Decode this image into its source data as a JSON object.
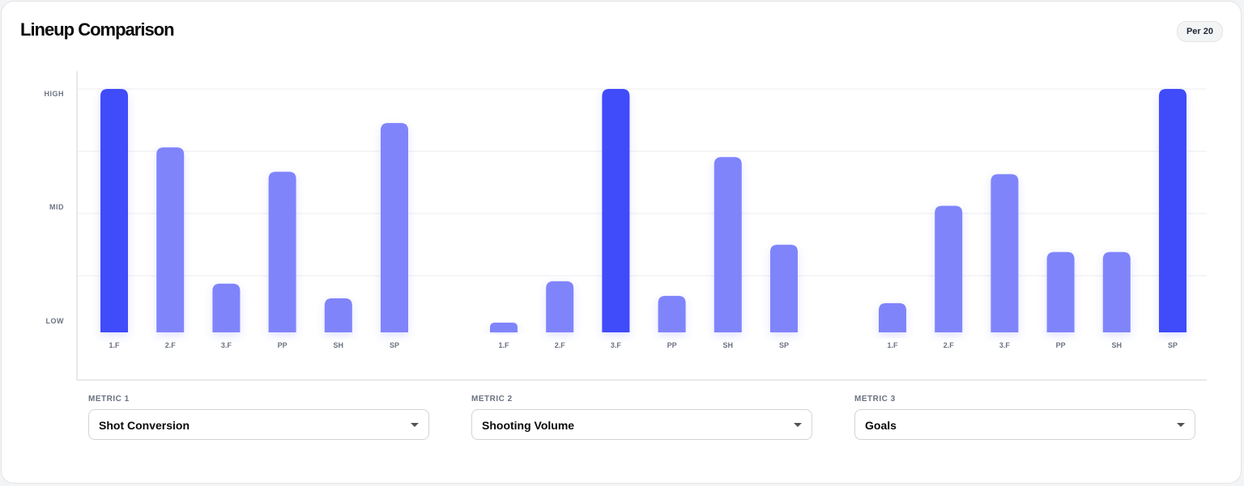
{
  "header": {
    "title": "Lineup Comparison",
    "badge": "Per 20"
  },
  "colors": {
    "highlight": "#3f4bfa",
    "bar": "#8084fb",
    "grid": "#ececf0",
    "axis": "#d4d4d8"
  },
  "metrics": [
    {
      "label": "METRIC 1",
      "value": "Shot Conversion",
      "icon": "chevron-down-icon"
    },
    {
      "label": "METRIC 2",
      "value": "Shooting Volume",
      "icon": "chevron-down-icon"
    },
    {
      "label": "METRIC 3",
      "value": "Goals",
      "icon": "chevron-down-icon"
    }
  ],
  "chart_data": {
    "type": "bar",
    "y_ticks": [
      "HIGH",
      "MID",
      "LOW"
    ],
    "ylim": [
      0,
      100
    ],
    "grid": true,
    "groups": [
      {
        "categories": [
          "1.F",
          "2.F",
          "3.F",
          "PP",
          "SH",
          "SP"
        ],
        "values": [
          100,
          76,
          20,
          66,
          14,
          86
        ],
        "highlight_index": 0
      },
      {
        "categories": [
          "1.F",
          "2.F",
          "3.F",
          "PP",
          "SH",
          "SP"
        ],
        "values": [
          4,
          21,
          100,
          15,
          72,
          36
        ],
        "highlight_index": 2
      },
      {
        "categories": [
          "1.F",
          "2.F",
          "3.F",
          "PP",
          "SH",
          "SP"
        ],
        "values": [
          12,
          52,
          65,
          33,
          33,
          100
        ],
        "highlight_index": 5
      }
    ]
  }
}
